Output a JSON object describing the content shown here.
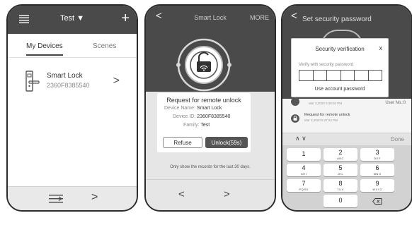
{
  "screen1": {
    "header": {
      "title": "Test ▼",
      "add_label": "+"
    },
    "tabs": [
      "My Devices",
      "Scenes"
    ],
    "device": {
      "name": "Smart Lock",
      "id": "2360F8385540",
      "chevron": ">"
    },
    "bottombar": {
      "next": ">"
    }
  },
  "screen2": {
    "header": {
      "back": "<",
      "title": "Smart Lock",
      "more": "MORE"
    },
    "card": {
      "title": "Request for remote unlock",
      "device_name_label": "Device Name:",
      "device_name": "Smart Lock",
      "device_id_label": "Device ID:",
      "device_id": "2360F8385540",
      "family_label": "Family:",
      "family": "Test",
      "refuse_label": "Refuse",
      "unlock_label": "Unlock(59s)"
    },
    "note": "Only show the records for the last 30 days.",
    "bottombar": {
      "back": "<",
      "next": ">"
    }
  },
  "screen3": {
    "header": {
      "back": "<",
      "title": "Set security password"
    },
    "dialog": {
      "title": "Security verification",
      "close": "x",
      "label": "Verify with security password",
      "use_account": "Use account password"
    },
    "log": {
      "item1_date": "Mar 3,2020 6:28:02 PM",
      "item1_user": "User No.:0",
      "item2_title": "Request for remote unlock",
      "item2_date": "Mar 3,2020 6:27:52 PM"
    },
    "keyboard": {
      "arrows": "∧ ∨",
      "done": "Done",
      "keys": [
        {
          "num": "1",
          "letters": ""
        },
        {
          "num": "2",
          "letters": "ABC"
        },
        {
          "num": "3",
          "letters": "DEF"
        },
        {
          "num": "4",
          "letters": "GHI"
        },
        {
          "num": "5",
          "letters": "JKL"
        },
        {
          "num": "6",
          "letters": "MNO"
        },
        {
          "num": "7",
          "letters": "PQRS"
        },
        {
          "num": "8",
          "letters": "TUV"
        },
        {
          "num": "9",
          "letters": "WXYZ"
        },
        {
          "num": "0",
          "letters": ""
        }
      ],
      "delete_icon": "backspace-icon"
    }
  }
}
